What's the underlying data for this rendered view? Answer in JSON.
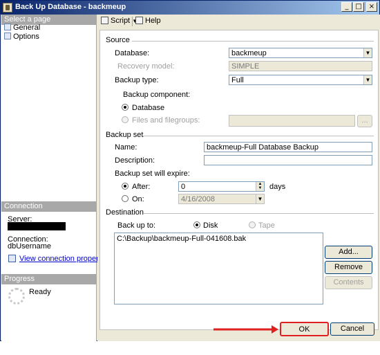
{
  "window": {
    "title": "Back Up Database - backmeup"
  },
  "titlebar_buttons": {
    "minimize": "_",
    "maximize": "□",
    "close": "×"
  },
  "left_panel": {
    "select_page_header": "Select a page",
    "pages": [
      {
        "label": "General",
        "icon": "page-icon"
      },
      {
        "label": "Options",
        "icon": "page-icon"
      }
    ],
    "connection_header": "Connection",
    "server_label": "Server:",
    "connection_label": "Connection:",
    "connection_value": "dbUsername",
    "view_connection_link": "View connection properties",
    "progress_header": "Progress",
    "progress_status": "Ready"
  },
  "toolbar": {
    "script_label": "Script",
    "help_label": "Help"
  },
  "source": {
    "heading": "Source",
    "database_label": "Database:",
    "database_value": "backmeup",
    "recovery_model_label": "Recovery model:",
    "recovery_model_value": "SIMPLE",
    "backup_type_label": "Backup type:",
    "backup_type_value": "Full",
    "backup_component_label": "Backup component:",
    "component_database_label": "Database",
    "component_files_label": "Files and filegroups:",
    "files_browse_label": "..."
  },
  "backup_set": {
    "heading": "Backup set",
    "name_label": "Name:",
    "name_value": "backmeup-Full Database Backup",
    "description_label": "Description:",
    "description_value": "",
    "expire_label": "Backup set will expire:",
    "after_label": "After:",
    "after_value": "0",
    "days_label": "days",
    "on_label": "On:",
    "on_value": "4/16/2008"
  },
  "destination": {
    "heading": "Destination",
    "backup_to_label": "Back up to:",
    "disk_label": "Disk",
    "tape_label": "Tape",
    "paths": [
      "C:\\Backup\\backmeup-Full-041608.bak"
    ],
    "add_label": "Add...",
    "remove_label": "Remove",
    "contents_label": "Contents"
  },
  "footer": {
    "ok_label": "OK",
    "cancel_label": "Cancel"
  },
  "colors": {
    "title_bar": "#0a246a",
    "arrow": "#e02020",
    "section_header": "#a8a8a8"
  }
}
